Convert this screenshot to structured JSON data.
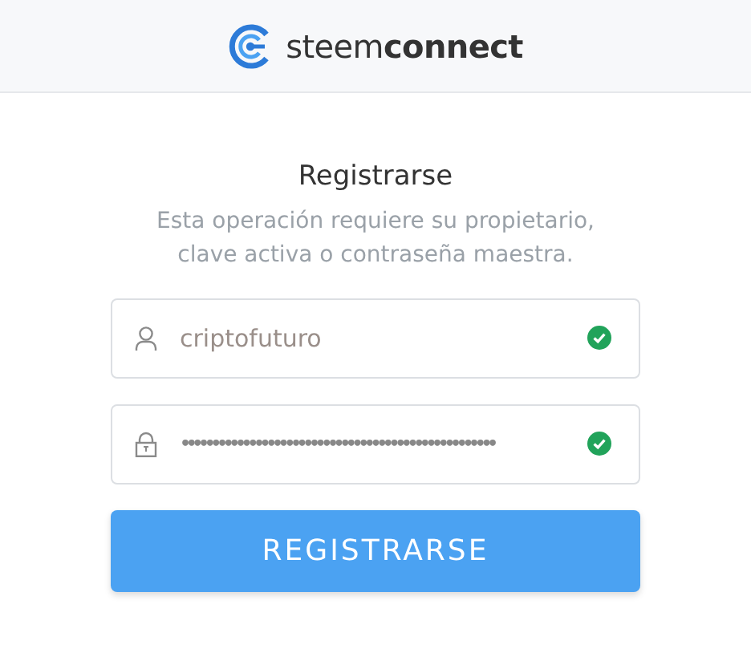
{
  "header": {
    "logo": "steem**connect**"
  },
  "title": "Registrarse",
  "subtitle": "Esta operación requiere su propietario, clave activa o contraseña maestra.",
  "fields": [
    {
      "kind": "user",
      "value": "criptofuturo",
      "valid": true
    },
    {
      "kind": "password",
      "value": "•••••••••••••••••••••••••••••••••••••••••••••••••••",
      "valid": true
    }
  ],
  "button": "REGISTRARSE"
}
